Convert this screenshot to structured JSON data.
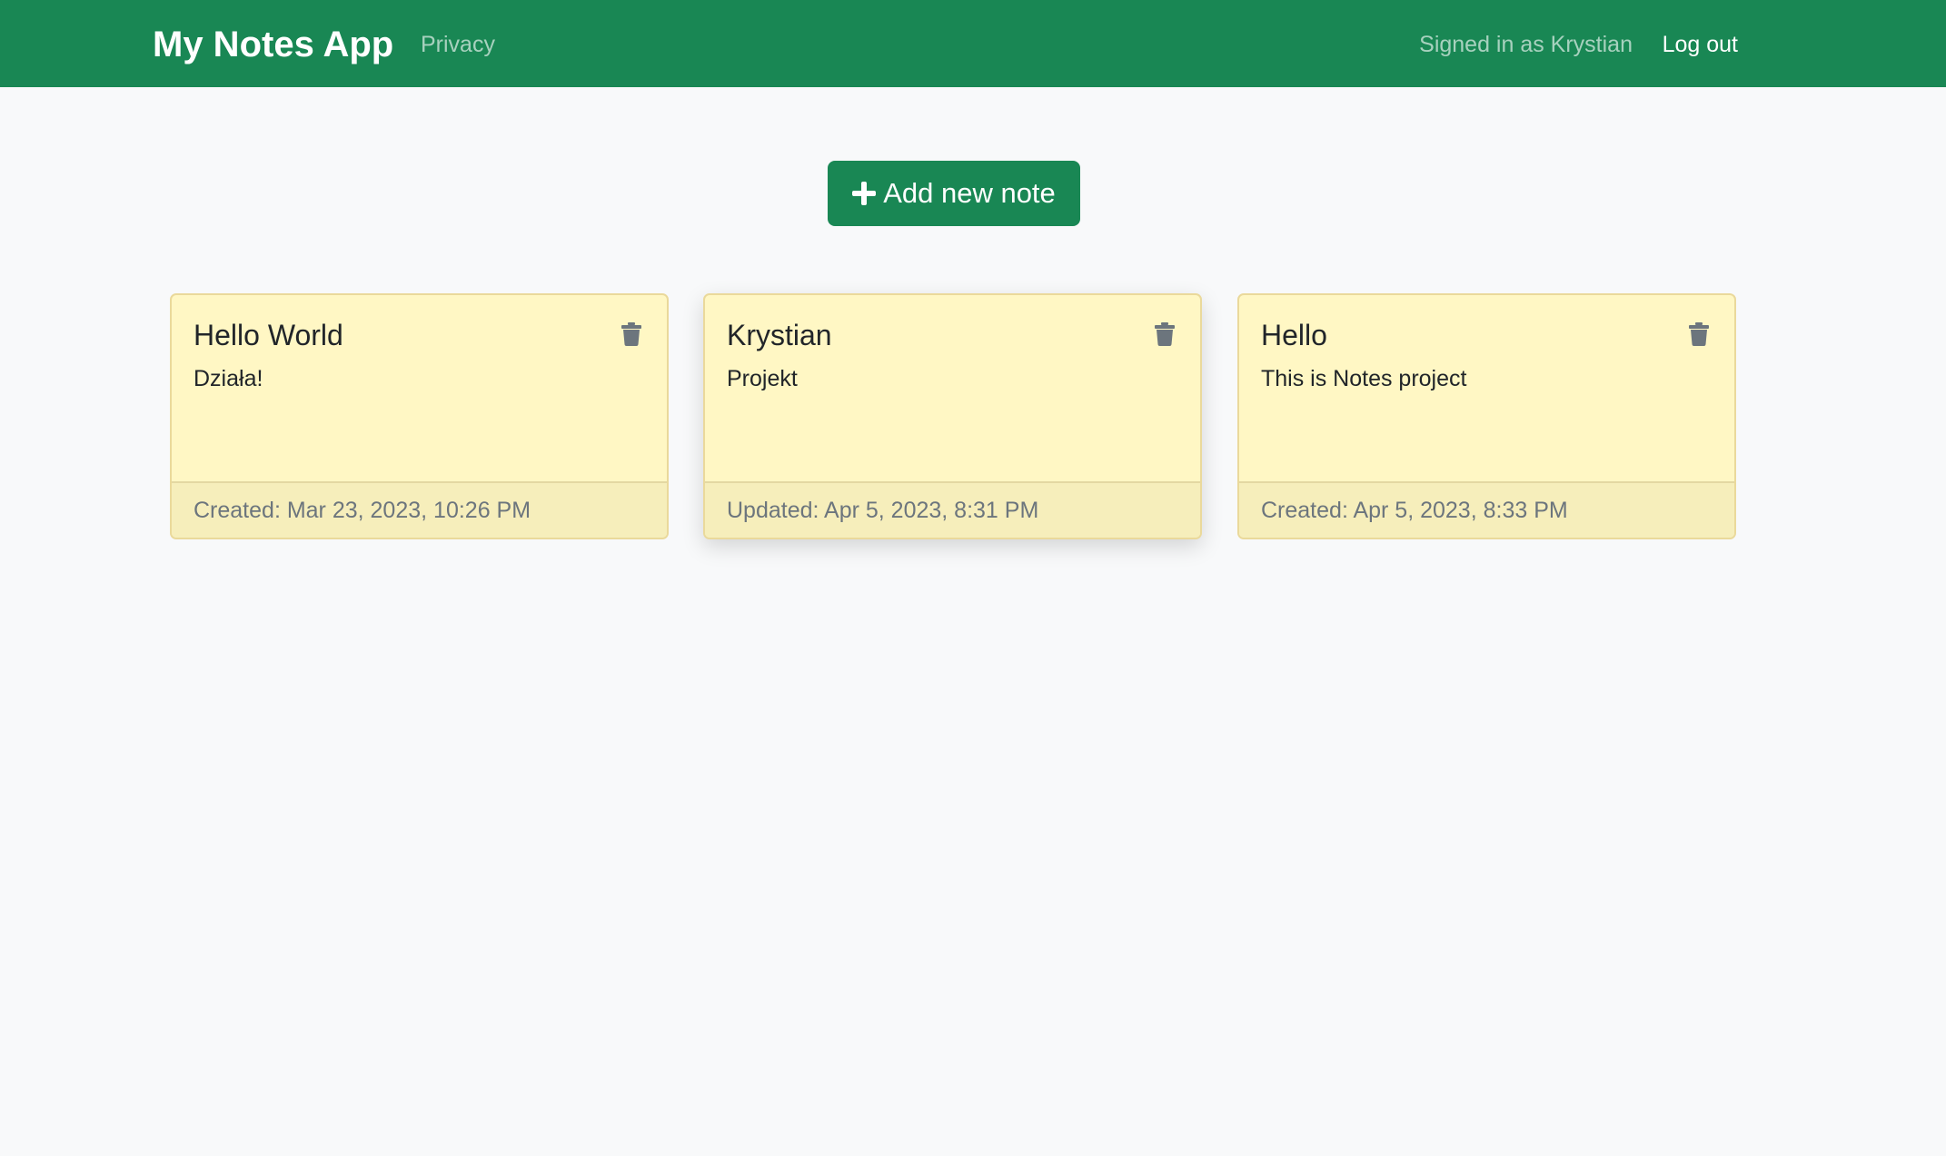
{
  "navbar": {
    "brand": "My Notes App",
    "privacy_link": "Privacy",
    "signed_in_text": "Signed in as Krystian",
    "logout_link": "Log out",
    "background_color": "#198754"
  },
  "main": {
    "add_note_button": {
      "icon": "plus-icon",
      "label": "Add new note"
    },
    "notes": [
      {
        "title": "Hello World",
        "content": "Działa!",
        "footer": "Created: Mar 23, 2023, 10:26 PM",
        "delete_icon": "trash-icon"
      },
      {
        "title": "Krystian",
        "content": "Projekt",
        "footer": "Updated: Apr 5, 2023, 8:31 PM",
        "delete_icon": "trash-icon"
      },
      {
        "title": "Hello",
        "content": "This is Notes project",
        "footer": "Created: Apr 5, 2023, 8:33 PM",
        "delete_icon": "trash-icon"
      }
    ],
    "note_card_color": "#fff7c4"
  }
}
